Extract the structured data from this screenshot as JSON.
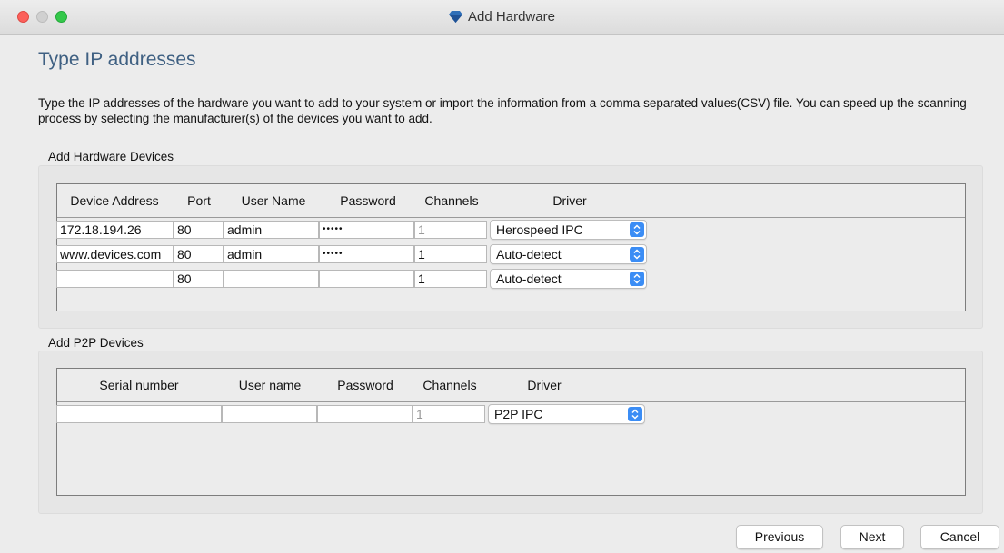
{
  "window": {
    "title": "Add Hardware"
  },
  "page": {
    "title": "Type IP addresses",
    "description": "Type the IP addresses of the hardware you want to add to your system or import the information from a comma separated values(CSV) file. You can speed up the scanning process by selecting the manufacturer(s) of the devices you want to add."
  },
  "hardware": {
    "group_label": "Add Hardware Devices",
    "columns": [
      "Device Address",
      "Port",
      "User Name",
      "Password",
      "Channels",
      "Driver"
    ],
    "rows": [
      {
        "address": "172.18.194.26",
        "port": "80",
        "user": "admin",
        "password": "•••••",
        "channels": "1",
        "driver": "Herospeed IPC"
      },
      {
        "address": "www.devices.com",
        "port": "80",
        "user": "admin",
        "password": "•••••",
        "channels": "1",
        "driver": "Auto-detect"
      },
      {
        "address": "",
        "port": "80",
        "user": "",
        "password": "",
        "channels": "1",
        "driver": "Auto-detect"
      }
    ]
  },
  "p2p": {
    "group_label": "Add P2P Devices",
    "columns": [
      "Serial number",
      "User name",
      "Password",
      "Channels",
      "Driver"
    ],
    "rows": [
      {
        "serial": "",
        "user": "",
        "password": "",
        "channels": "1",
        "driver": "P2P IPC"
      }
    ]
  },
  "buttons": {
    "previous": "Previous",
    "next": "Next",
    "cancel": "Cancel"
  },
  "colors": {
    "title_blue": "#3f6082",
    "select_accent": "#3b8df5"
  }
}
